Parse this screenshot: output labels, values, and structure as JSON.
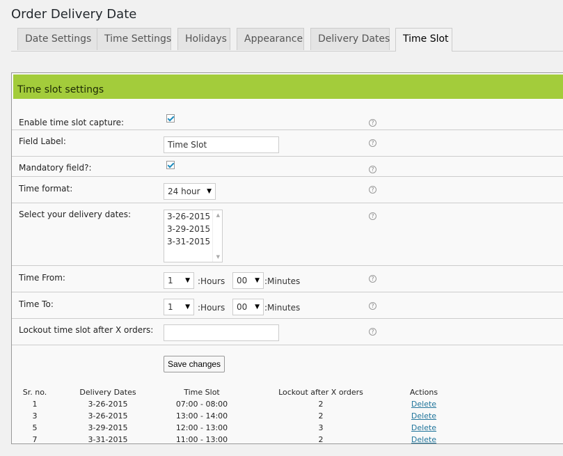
{
  "page": {
    "title": "Order Delivery Date"
  },
  "tabs": [
    {
      "label": "Date Settings"
    },
    {
      "label": "Time Settings"
    },
    {
      "label": "Holidays"
    },
    {
      "label": "Appearance"
    },
    {
      "label": "Delivery Dates"
    },
    {
      "label": "Time Slot"
    }
  ],
  "section": {
    "title": "Time slot settings"
  },
  "form": {
    "enable_capture": {
      "label": "Enable time slot capture:",
      "checked": true
    },
    "field_label": {
      "label": "Field Label:",
      "value": "Time Slot"
    },
    "mandatory": {
      "label": "Mandatory field?:",
      "checked": true
    },
    "time_format": {
      "label": "Time format:",
      "value": "24 hour"
    },
    "delivery_dates": {
      "label": "Select your delivery dates:",
      "options": [
        "3-26-2015",
        "3-29-2015",
        "3-31-2015"
      ]
    },
    "time_from": {
      "label": "Time From:",
      "hours": "1",
      "hours_suffix": ":Hours",
      "minutes": "00",
      "minutes_suffix": ":Minutes"
    },
    "time_to": {
      "label": "Time To:",
      "hours": "1",
      "hours_suffix": ":Hours",
      "minutes": "00",
      "minutes_suffix": ":Minutes"
    },
    "lockout": {
      "label": "Lockout time slot after X orders:",
      "value": ""
    },
    "help_glyph": "?",
    "save_label": "Save changes"
  },
  "slots_table": {
    "headers": [
      "Sr. no.",
      "Delivery Dates",
      "Time Slot",
      "Lockout after X orders",
      "Actions"
    ],
    "rows": [
      {
        "sr": "1",
        "date": "3-26-2015",
        "slot": "07:00 - 08:00",
        "lockout": "2",
        "action": "Delete"
      },
      {
        "sr": "3",
        "date": "3-26-2015",
        "slot": "13:00 - 14:00",
        "lockout": "2",
        "action": "Delete"
      },
      {
        "sr": "5",
        "date": "3-29-2015",
        "slot": "12:00 - 13:00",
        "lockout": "3",
        "action": "Delete"
      },
      {
        "sr": "7",
        "date": "3-31-2015",
        "slot": "11:00 - 13:00",
        "lockout": "2",
        "action": "Delete"
      }
    ]
  },
  "colors": {
    "section_header": "#a3cc3b",
    "link": "#21759b",
    "checkmark": "#1e8cbe"
  }
}
